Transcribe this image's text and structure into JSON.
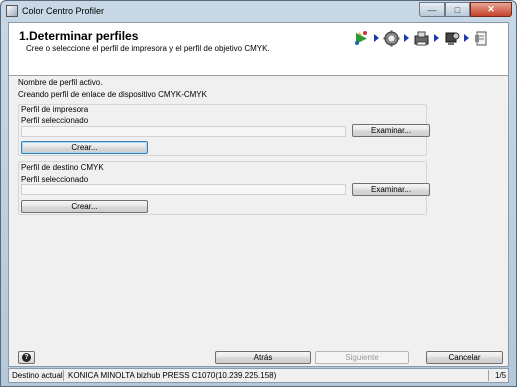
{
  "window": {
    "title": "Color Centro Profiler",
    "close_glyph": "✕",
    "min_glyph": "—",
    "max_glyph": "□"
  },
  "header": {
    "title": "1.Determinar perfiles",
    "subtitle": "Cree o seleccione el perfil de impresora y el perfil de objetivo CMYK.",
    "steps": [
      "wizard-start-icon",
      "gear-icon",
      "printer-icon",
      "scanner-icon",
      "document-icon"
    ]
  },
  "main": {
    "active_profile_label": "Nombre de perfil activo.",
    "active_profile_value": "Creando perfil de enlace de dispositivo CMYK-CMYK",
    "printer_group": {
      "title": "Perfil de impresora",
      "selected_label": "Perfil seleccionado",
      "selected_value": "",
      "browse_label": "Examinar...",
      "create_label": "Crear..."
    },
    "target_group": {
      "title": "Perfil de destino CMYK",
      "selected_label": "Perfil seleccionado",
      "selected_value": "",
      "browse_label": "Examinar...",
      "create_label": "Crear..."
    }
  },
  "footer": {
    "back_label": "Atrás",
    "next_label": "Siguiente",
    "cancel_label": "Cancelar"
  },
  "statusbar": {
    "destination_label": "Destino actual",
    "destination_value": "KONICA MINOLTA bizhub PRESS C1070(10.239.225.158)",
    "page": "1/5"
  }
}
